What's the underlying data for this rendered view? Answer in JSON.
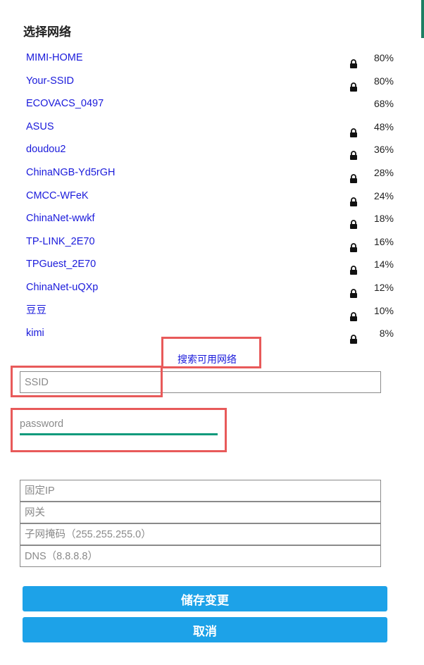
{
  "header": {
    "title": "选择网络"
  },
  "networks": [
    {
      "ssid": "MIMI-HOME",
      "locked": true,
      "signal": "80%"
    },
    {
      "ssid": "Your-SSID",
      "locked": true,
      "signal": "80%"
    },
    {
      "ssid": "ECOVACS_0497",
      "locked": false,
      "signal": "68%"
    },
    {
      "ssid": "ASUS",
      "locked": true,
      "signal": "48%"
    },
    {
      "ssid": "doudou2",
      "locked": true,
      "signal": "36%"
    },
    {
      "ssid": "ChinaNGB-Yd5rGH",
      "locked": true,
      "signal": "28%"
    },
    {
      "ssid": "CMCC-WFeK",
      "locked": true,
      "signal": "24%"
    },
    {
      "ssid": "ChinaNet-wwkf",
      "locked": true,
      "signal": "18%"
    },
    {
      "ssid": "TP-LINK_2E70",
      "locked": true,
      "signal": "16%"
    },
    {
      "ssid": "TPGuest_2E70",
      "locked": true,
      "signal": "14%"
    },
    {
      "ssid": "ChinaNet-uQXp",
      "locked": true,
      "signal": "12%"
    },
    {
      "ssid": "豆豆",
      "locked": true,
      "signal": "10%"
    },
    {
      "ssid": "kimi",
      "locked": true,
      "signal": "8%"
    }
  ],
  "scan": {
    "label": "搜索可用网络"
  },
  "form": {
    "ssid_placeholder": "SSID",
    "password_placeholder": "password",
    "static_ip_placeholder": "固定IP",
    "gateway_placeholder": "网关",
    "subnet_placeholder": "子网掩码（255.255.255.0）",
    "dns_placeholder": "DNS（8.8.8.8）"
  },
  "actions": {
    "save_label": "储存变更",
    "cancel_label": "取消"
  },
  "colors": {
    "link": "#1a1adb",
    "button": "#1da2e8",
    "highlight": "#e85a5a",
    "focus_underline": "#0e9a7c"
  }
}
